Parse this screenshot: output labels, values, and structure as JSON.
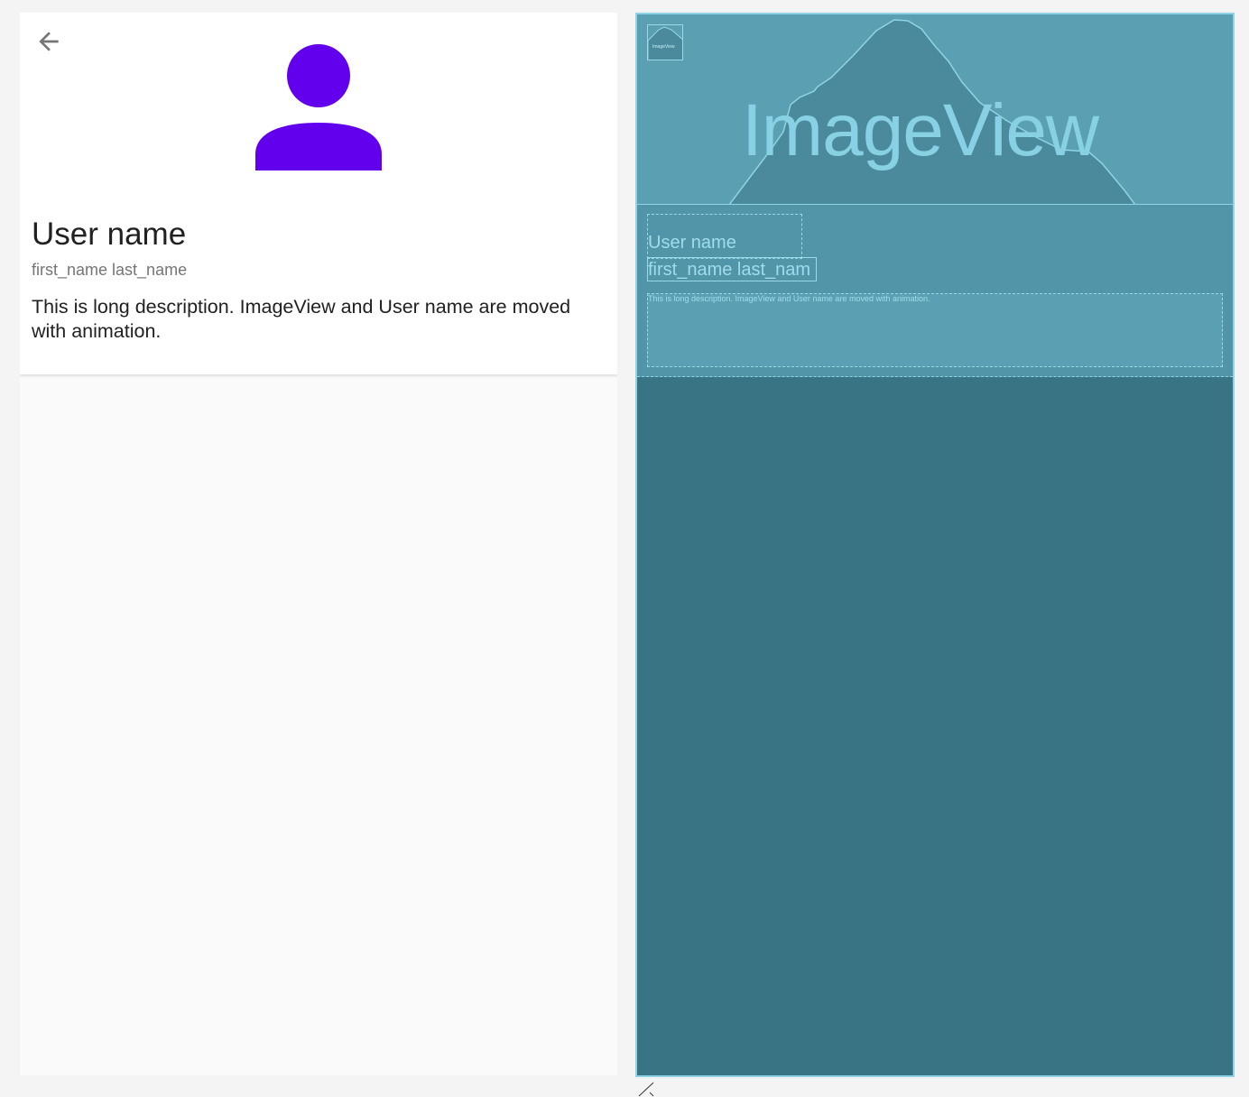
{
  "design": {
    "back_icon": "arrow-back-icon",
    "avatar_icon": "person-icon",
    "avatar_color": "#6200ee",
    "user_name": "User name",
    "user_subtitle": "first_name last_name",
    "description": "This is long description. ImageView and User name are moved with animation."
  },
  "blueprint": {
    "header_image_label": "ImageView",
    "back_image_label": "ImageView",
    "user_name": "User name",
    "user_subtitle": "first_name last_nam",
    "description": "This is long description. ImageView and User name are moved with animation.",
    "background_color": "#387484",
    "outline_color": "#8fd3e6"
  }
}
